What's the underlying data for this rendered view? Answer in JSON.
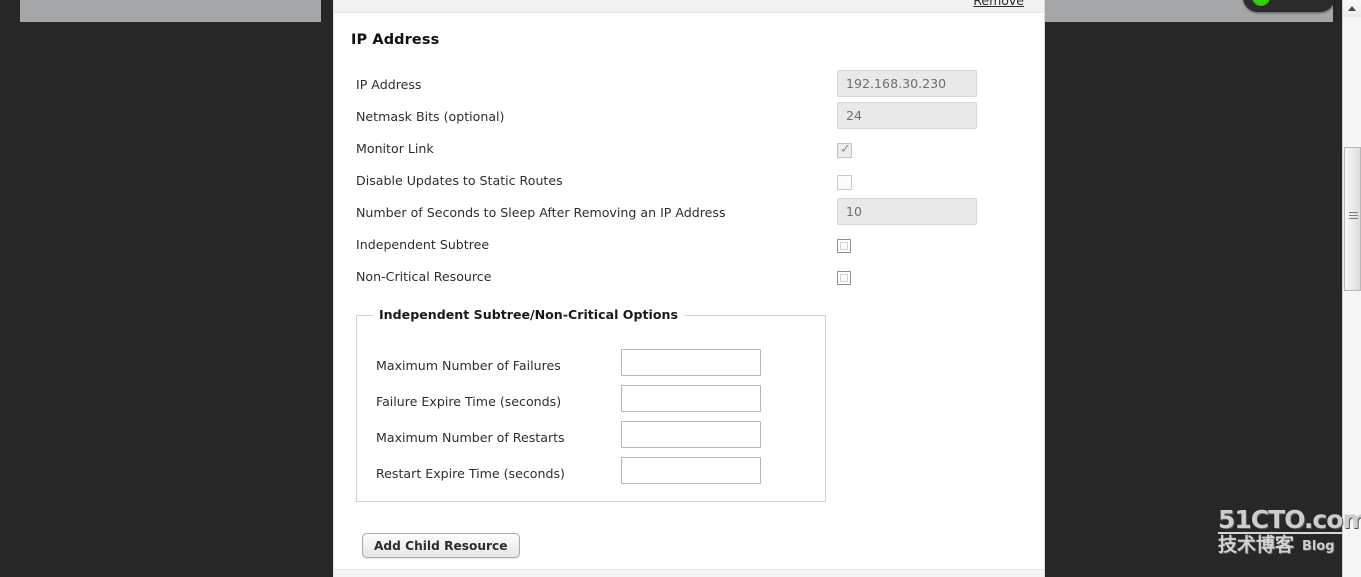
{
  "page": {
    "title": "IP Address",
    "remove_link": "Remove"
  },
  "ip_form": {
    "rows": [
      {
        "label": "IP Address",
        "type": "text-readonly",
        "value": "192.168.30.230"
      },
      {
        "label": "Netmask Bits (optional)",
        "type": "text-readonly",
        "value": "24"
      },
      {
        "label": "Monitor Link",
        "type": "checkbox-themed",
        "checked": true,
        "tick": "✓"
      },
      {
        "label": "Disable Updates to Static Routes",
        "type": "checkbox-themed",
        "checked": false,
        "tick": ""
      },
      {
        "label": "Number of Seconds to Sleep After Removing an IP Address",
        "type": "text-readonly",
        "value": "10"
      },
      {
        "label": "Independent Subtree",
        "type": "checkbox-native",
        "checked": false
      },
      {
        "label": "Non-Critical Resource",
        "type": "checkbox-native",
        "checked": false
      }
    ]
  },
  "fieldset": {
    "legend": "Independent Subtree/Non-Critical Options",
    "rows": [
      {
        "label": "Maximum Number of Failures",
        "value": "",
        "placeholder": ""
      },
      {
        "label": "Failure Expire Time (seconds)",
        "value": "",
        "placeholder": ""
      },
      {
        "label": "Maximum Number of Restarts",
        "value": "",
        "placeholder": ""
      },
      {
        "label": "Restart Expire Time (seconds)",
        "value": "",
        "placeholder": ""
      }
    ]
  },
  "actions": {
    "add_child_resource": "Add Child Resource"
  },
  "watermark": {
    "main": "51CTO.com",
    "chinese": "技术博客",
    "blog": "Blog"
  },
  "colors": {
    "desktop_bg": "#272727",
    "panel_bg": "#ffffff",
    "readonly_field_bg": "#e9e9e9",
    "status_dot": "#37d017"
  }
}
